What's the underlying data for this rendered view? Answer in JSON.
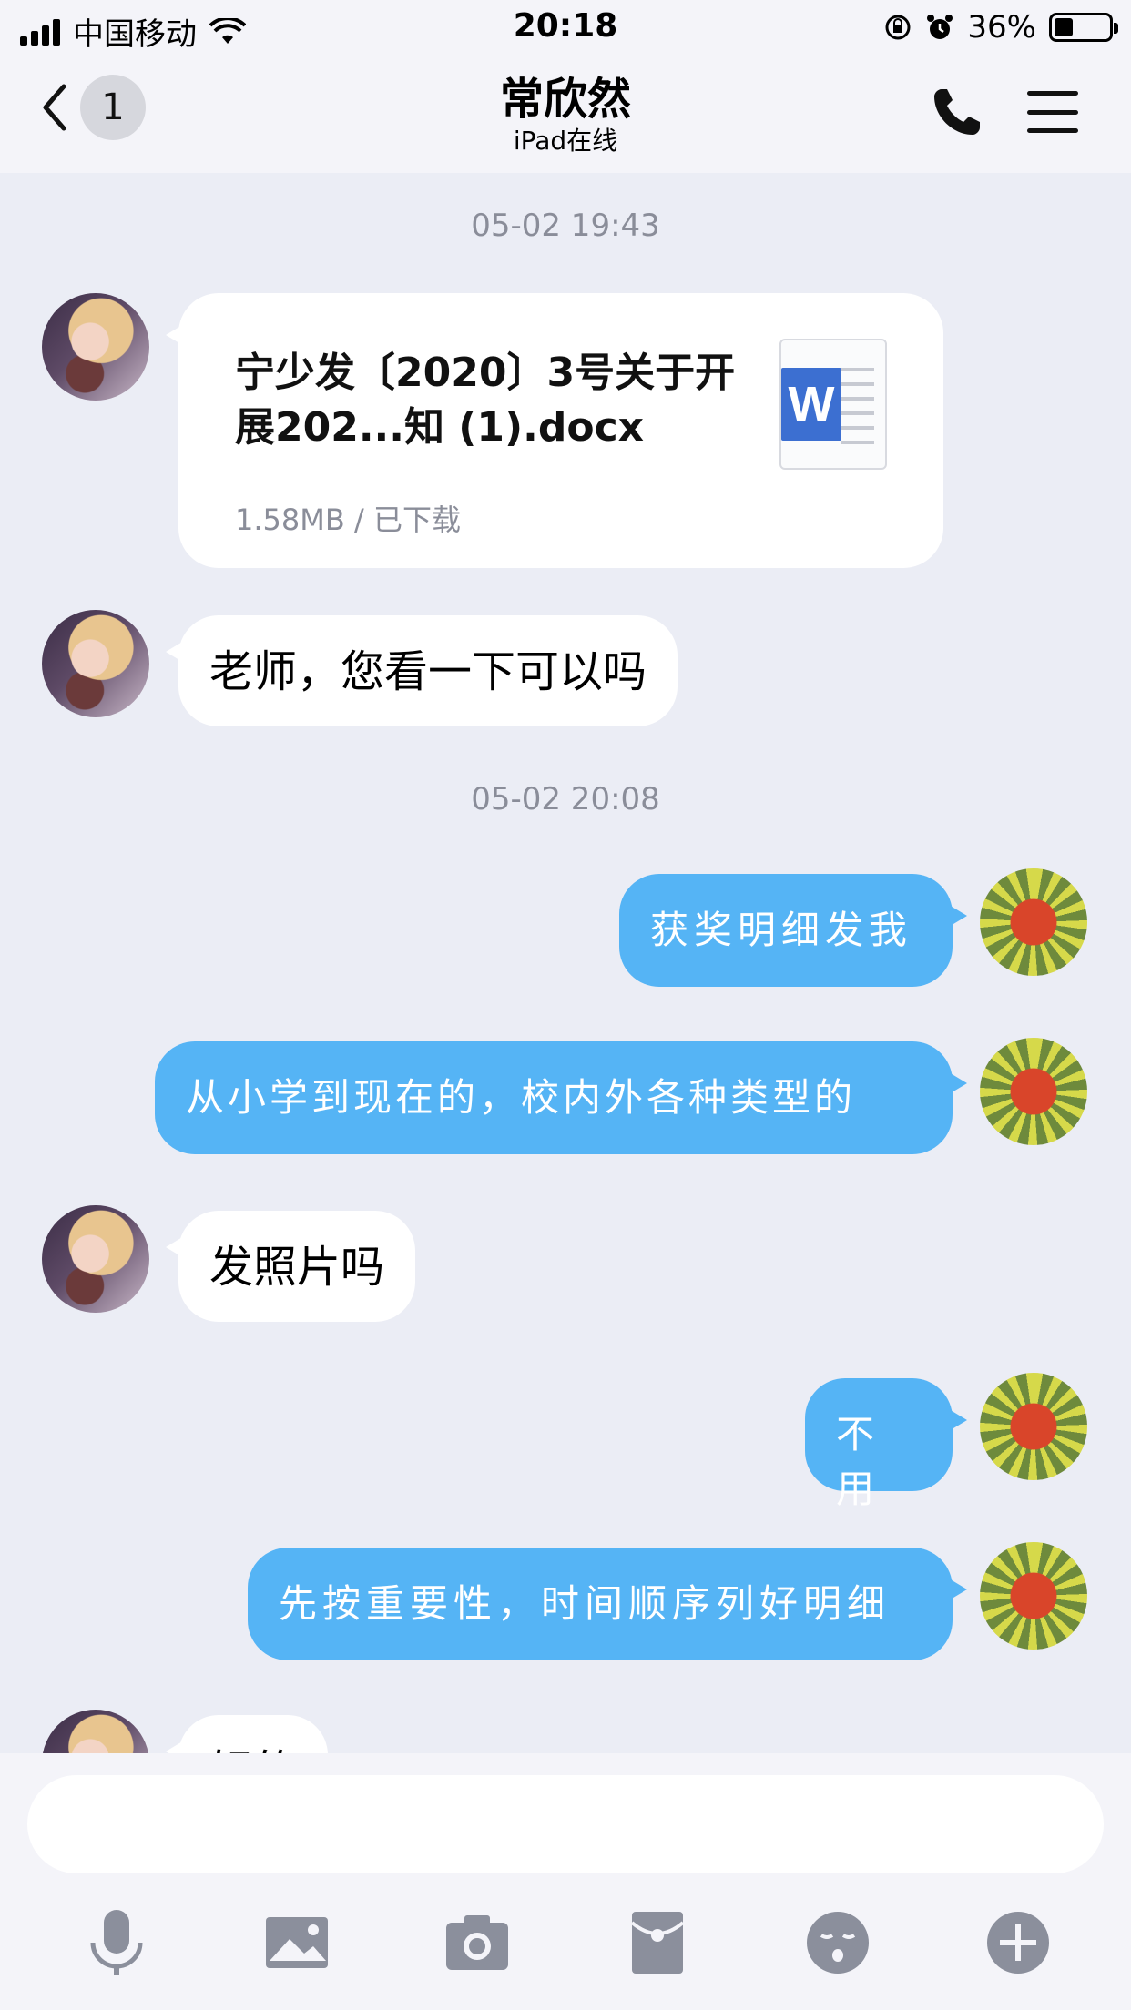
{
  "status_bar": {
    "carrier": "中国移动",
    "time": "20:18",
    "battery": "36%"
  },
  "nav": {
    "back_badge": "1",
    "contact_name": "常欣然",
    "contact_status": "iPad在线"
  },
  "messages": {
    "ts1": "05-02 19:43",
    "file": {
      "name": "宁少发〔2020〕3号关于开展202...知 (1).docx",
      "meta": "1.58MB / 已下载"
    },
    "m1": "老师，您看一下可以吗",
    "ts2": "05-02 20:08",
    "m2": "获奖明细发我",
    "m3": "从小学到现在的，校内外各种类型的",
    "m4": "发照片吗",
    "m5": "不用",
    "m6": "先按重要性，时间顺序列好明细",
    "m7": "好的"
  },
  "composer": {
    "input_value": "",
    "toolbar": [
      "microphone-icon",
      "image-icon",
      "camera-icon",
      "red-packet-icon",
      "emoji-icon",
      "plus-icon"
    ]
  },
  "colors": {
    "background": "#ebedf5",
    "self_bubble": "#55b4f5",
    "peer_bubble": "#ffffff",
    "word_blue": "#3c6fd1"
  }
}
